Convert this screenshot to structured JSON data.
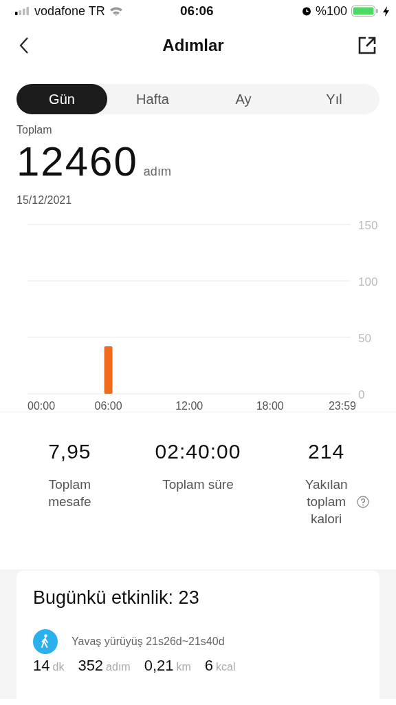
{
  "status_bar": {
    "carrier": "vodafone TR",
    "time": "06:06",
    "battery": "%100"
  },
  "header": {
    "title": "Adımlar"
  },
  "tabs": [
    {
      "label": "Gün",
      "selected": true
    },
    {
      "label": "Hafta",
      "selected": false
    },
    {
      "label": "Ay",
      "selected": false
    },
    {
      "label": "Yıl",
      "selected": false
    }
  ],
  "summary": {
    "label": "Toplam",
    "value": "12460",
    "unit": "adım",
    "date": "15/12/2021"
  },
  "chart_data": {
    "type": "bar",
    "x": [
      6
    ],
    "series": [
      {
        "color": "#f26b1d",
        "values": [
          42
        ]
      }
    ],
    "xlim": [
      0,
      23.983
    ],
    "ylim": [
      0,
      150
    ],
    "xticks": [
      {
        "value": 0,
        "label": "00:00"
      },
      {
        "value": 6,
        "label": "06:00"
      },
      {
        "value": 12,
        "label": "12:00"
      },
      {
        "value": 18,
        "label": "18:00"
      },
      {
        "value": 23.983,
        "label": "23:59"
      }
    ],
    "yticks": [
      0,
      50,
      100,
      150
    ]
  },
  "stats": [
    {
      "value": "7,95",
      "label": "Toplam mesafe",
      "info": false
    },
    {
      "value": "02:40:00",
      "label": "Toplam süre",
      "info": false
    },
    {
      "value": "214",
      "label": "Yakılan toplam kalori",
      "info": true
    }
  ],
  "activity": {
    "title": "Bugünkü etkinlik: 23",
    "items": [
      {
        "name": "Yavaş yürüyüş 21s26d~21s40d",
        "metrics": [
          {
            "value": "14",
            "unit": "dk"
          },
          {
            "value": "352",
            "unit": "adım"
          },
          {
            "value": "0,21",
            "unit": "km"
          },
          {
            "value": "6",
            "unit": "kcal"
          }
        ]
      }
    ]
  }
}
